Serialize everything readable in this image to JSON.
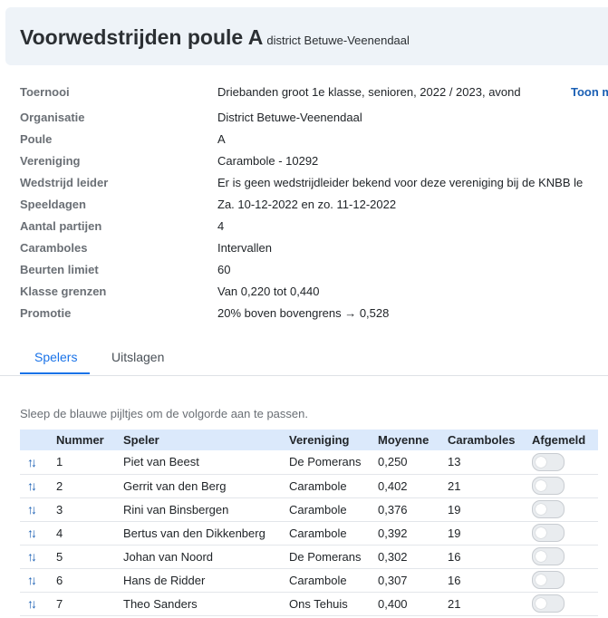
{
  "header": {
    "title": "Voorwedstrijden poule A",
    "subtitle": "district Betuwe-Veenendaal"
  },
  "info": [
    {
      "label": "Toernooi",
      "value": "Driebanden groot 1e klasse, senioren, 2022 / 2023, avond"
    },
    {
      "label": "Organisatie",
      "value": "District Betuwe-Veenendaal"
    },
    {
      "label": "Poule",
      "value": "A"
    },
    {
      "label": "Vereniging",
      "value": "Carambole - 10292"
    },
    {
      "label": "Wedstrijd leider",
      "value": "Er is geen wedstrijdleider bekend voor deze vereniging bij de KNBB le"
    },
    {
      "label": "Speeldagen",
      "value": "Za. 10-12-2022 en zo. 11-12-2022"
    },
    {
      "label": "Aantal partijen",
      "value": "4"
    },
    {
      "label": "Caramboles",
      "value": "Intervallen"
    },
    {
      "label": "Beurten limiet",
      "value": "60"
    },
    {
      "label": "Klasse grenzen",
      "value": "Van 0,220 tot 0,440"
    },
    {
      "label": "Promotie",
      "value": "20% boven bovengrens → 0,528"
    }
  ],
  "info_link": "Toon m",
  "tabs": [
    {
      "label": "Spelers",
      "active": true
    },
    {
      "label": "Uitslagen",
      "active": false
    }
  ],
  "hint": "Sleep de blauwe pijltjes om de volgorde aan te passen.",
  "table": {
    "headers": [
      "",
      "Nummer",
      "Speler",
      "Vereniging",
      "Moyenne",
      "Caramboles",
      "Afgemeld"
    ],
    "rows": [
      {
        "nummer": "1",
        "speler": "Piet van Beest",
        "vereniging": "De Pomerans",
        "moyenne": "0,250",
        "caramboles": "13",
        "afgemeld": false
      },
      {
        "nummer": "2",
        "speler": "Gerrit van den Berg",
        "vereniging": "Carambole",
        "moyenne": "0,402",
        "caramboles": "21",
        "afgemeld": false
      },
      {
        "nummer": "3",
        "speler": "Rini van Binsbergen",
        "vereniging": "Carambole",
        "moyenne": "0,376",
        "caramboles": "19",
        "afgemeld": false
      },
      {
        "nummer": "4",
        "speler": "Bertus van den Dikkenberg",
        "vereniging": "Carambole",
        "moyenne": "0,392",
        "caramboles": "19",
        "afgemeld": false
      },
      {
        "nummer": "5",
        "speler": "Johan van Noord",
        "vereniging": "De Pomerans",
        "moyenne": "0,302",
        "caramboles": "16",
        "afgemeld": false
      },
      {
        "nummer": "6",
        "speler": "Hans de Ridder",
        "vereniging": "Carambole",
        "moyenne": "0,307",
        "caramboles": "16",
        "afgemeld": false
      },
      {
        "nummer": "7",
        "speler": "Theo Sanders",
        "vereniging": "Ons Tehuis",
        "moyenne": "0,400",
        "caramboles": "21",
        "afgemeld": false
      }
    ]
  },
  "icons": {
    "drag_handle": "sort-arrows-icon"
  },
  "colors": {
    "accent": "#1a73e8",
    "header_bg": "#eef3f8",
    "table_header_bg": "#dbe9fb"
  }
}
